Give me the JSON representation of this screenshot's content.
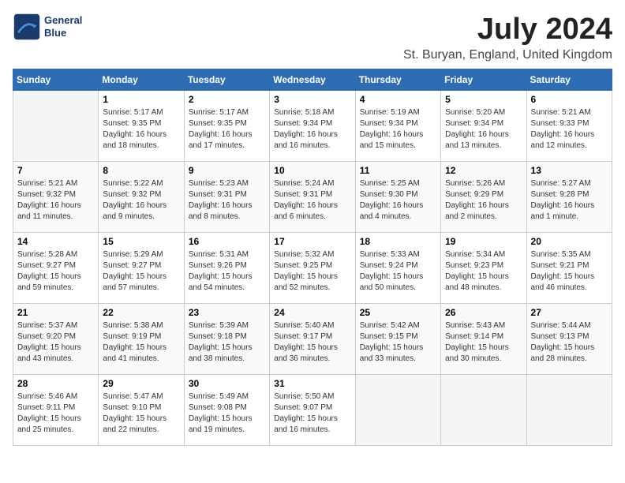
{
  "logo": {
    "line1": "General",
    "line2": "Blue"
  },
  "title": "July 2024",
  "location": "St. Buryan, England, United Kingdom",
  "weekdays": [
    "Sunday",
    "Monday",
    "Tuesday",
    "Wednesday",
    "Thursday",
    "Friday",
    "Saturday"
  ],
  "weeks": [
    [
      {
        "day": "",
        "empty": true
      },
      {
        "day": "1",
        "sunrise": "Sunrise: 5:17 AM",
        "sunset": "Sunset: 9:35 PM",
        "daylight": "Daylight: 16 hours and 18 minutes."
      },
      {
        "day": "2",
        "sunrise": "Sunrise: 5:17 AM",
        "sunset": "Sunset: 9:35 PM",
        "daylight": "Daylight: 16 hours and 17 minutes."
      },
      {
        "day": "3",
        "sunrise": "Sunrise: 5:18 AM",
        "sunset": "Sunset: 9:34 PM",
        "daylight": "Daylight: 16 hours and 16 minutes."
      },
      {
        "day": "4",
        "sunrise": "Sunrise: 5:19 AM",
        "sunset": "Sunset: 9:34 PM",
        "daylight": "Daylight: 16 hours and 15 minutes."
      },
      {
        "day": "5",
        "sunrise": "Sunrise: 5:20 AM",
        "sunset": "Sunset: 9:34 PM",
        "daylight": "Daylight: 16 hours and 13 minutes."
      },
      {
        "day": "6",
        "sunrise": "Sunrise: 5:21 AM",
        "sunset": "Sunset: 9:33 PM",
        "daylight": "Daylight: 16 hours and 12 minutes."
      }
    ],
    [
      {
        "day": "7",
        "sunrise": "Sunrise: 5:21 AM",
        "sunset": "Sunset: 9:32 PM",
        "daylight": "Daylight: 16 hours and 11 minutes."
      },
      {
        "day": "8",
        "sunrise": "Sunrise: 5:22 AM",
        "sunset": "Sunset: 9:32 PM",
        "daylight": "Daylight: 16 hours and 9 minutes."
      },
      {
        "day": "9",
        "sunrise": "Sunrise: 5:23 AM",
        "sunset": "Sunset: 9:31 PM",
        "daylight": "Daylight: 16 hours and 8 minutes."
      },
      {
        "day": "10",
        "sunrise": "Sunrise: 5:24 AM",
        "sunset": "Sunset: 9:31 PM",
        "daylight": "Daylight: 16 hours and 6 minutes."
      },
      {
        "day": "11",
        "sunrise": "Sunrise: 5:25 AM",
        "sunset": "Sunset: 9:30 PM",
        "daylight": "Daylight: 16 hours and 4 minutes."
      },
      {
        "day": "12",
        "sunrise": "Sunrise: 5:26 AM",
        "sunset": "Sunset: 9:29 PM",
        "daylight": "Daylight: 16 hours and 2 minutes."
      },
      {
        "day": "13",
        "sunrise": "Sunrise: 5:27 AM",
        "sunset": "Sunset: 9:28 PM",
        "daylight": "Daylight: 16 hours and 1 minute."
      }
    ],
    [
      {
        "day": "14",
        "sunrise": "Sunrise: 5:28 AM",
        "sunset": "Sunset: 9:27 PM",
        "daylight": "Daylight: 15 hours and 59 minutes."
      },
      {
        "day": "15",
        "sunrise": "Sunrise: 5:29 AM",
        "sunset": "Sunset: 9:27 PM",
        "daylight": "Daylight: 15 hours and 57 minutes."
      },
      {
        "day": "16",
        "sunrise": "Sunrise: 5:31 AM",
        "sunset": "Sunset: 9:26 PM",
        "daylight": "Daylight: 15 hours and 54 minutes."
      },
      {
        "day": "17",
        "sunrise": "Sunrise: 5:32 AM",
        "sunset": "Sunset: 9:25 PM",
        "daylight": "Daylight: 15 hours and 52 minutes."
      },
      {
        "day": "18",
        "sunrise": "Sunrise: 5:33 AM",
        "sunset": "Sunset: 9:24 PM",
        "daylight": "Daylight: 15 hours and 50 minutes."
      },
      {
        "day": "19",
        "sunrise": "Sunrise: 5:34 AM",
        "sunset": "Sunset: 9:23 PM",
        "daylight": "Daylight: 15 hours and 48 minutes."
      },
      {
        "day": "20",
        "sunrise": "Sunrise: 5:35 AM",
        "sunset": "Sunset: 9:21 PM",
        "daylight": "Daylight: 15 hours and 46 minutes."
      }
    ],
    [
      {
        "day": "21",
        "sunrise": "Sunrise: 5:37 AM",
        "sunset": "Sunset: 9:20 PM",
        "daylight": "Daylight: 15 hours and 43 minutes."
      },
      {
        "day": "22",
        "sunrise": "Sunrise: 5:38 AM",
        "sunset": "Sunset: 9:19 PM",
        "daylight": "Daylight: 15 hours and 41 minutes."
      },
      {
        "day": "23",
        "sunrise": "Sunrise: 5:39 AM",
        "sunset": "Sunset: 9:18 PM",
        "daylight": "Daylight: 15 hours and 38 minutes."
      },
      {
        "day": "24",
        "sunrise": "Sunrise: 5:40 AM",
        "sunset": "Sunset: 9:17 PM",
        "daylight": "Daylight: 15 hours and 36 minutes."
      },
      {
        "day": "25",
        "sunrise": "Sunrise: 5:42 AM",
        "sunset": "Sunset: 9:15 PM",
        "daylight": "Daylight: 15 hours and 33 minutes."
      },
      {
        "day": "26",
        "sunrise": "Sunrise: 5:43 AM",
        "sunset": "Sunset: 9:14 PM",
        "daylight": "Daylight: 15 hours and 30 minutes."
      },
      {
        "day": "27",
        "sunrise": "Sunrise: 5:44 AM",
        "sunset": "Sunset: 9:13 PM",
        "daylight": "Daylight: 15 hours and 28 minutes."
      }
    ],
    [
      {
        "day": "28",
        "sunrise": "Sunrise: 5:46 AM",
        "sunset": "Sunset: 9:11 PM",
        "daylight": "Daylight: 15 hours and 25 minutes."
      },
      {
        "day": "29",
        "sunrise": "Sunrise: 5:47 AM",
        "sunset": "Sunset: 9:10 PM",
        "daylight": "Daylight: 15 hours and 22 minutes."
      },
      {
        "day": "30",
        "sunrise": "Sunrise: 5:49 AM",
        "sunset": "Sunset: 9:08 PM",
        "daylight": "Daylight: 15 hours and 19 minutes."
      },
      {
        "day": "31",
        "sunrise": "Sunrise: 5:50 AM",
        "sunset": "Sunset: 9:07 PM",
        "daylight": "Daylight: 15 hours and 16 minutes."
      },
      {
        "day": "",
        "empty": true
      },
      {
        "day": "",
        "empty": true
      },
      {
        "day": "",
        "empty": true
      }
    ]
  ]
}
